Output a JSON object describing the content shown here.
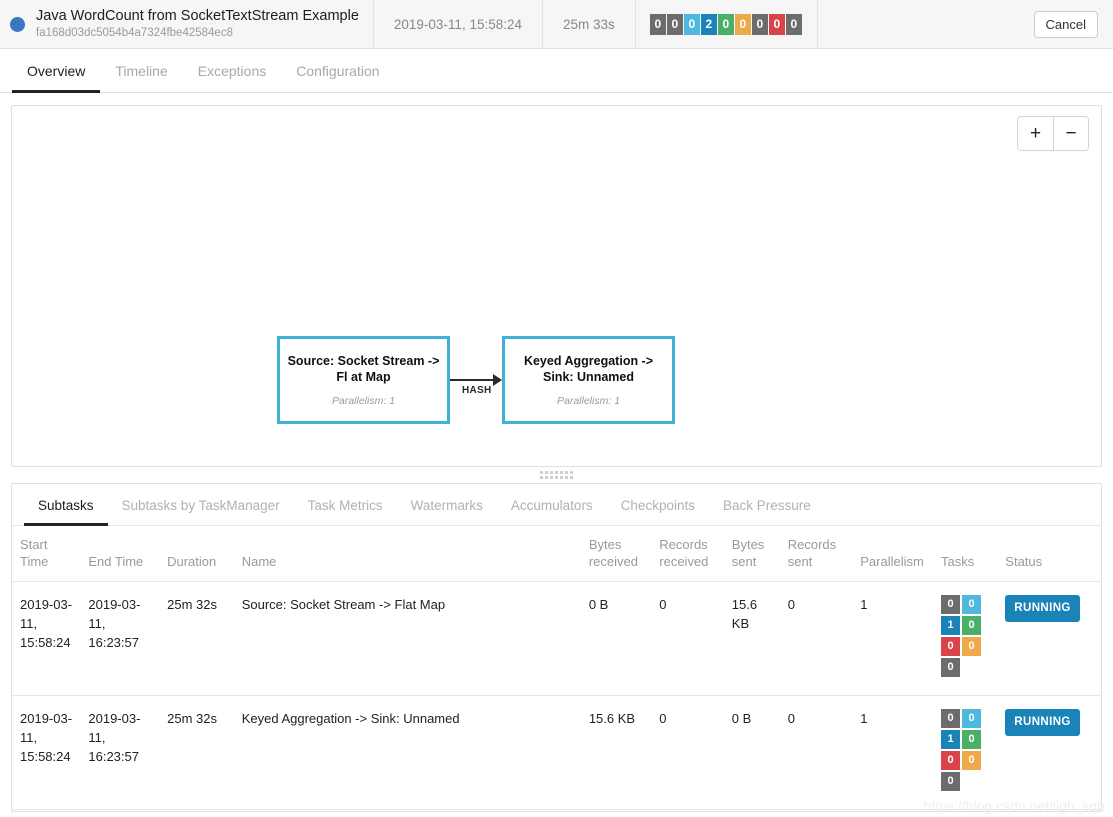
{
  "job_header": {
    "status_icon": "status-dot-running",
    "status_color": "#3b77c0",
    "job_name": "Java WordCount from SocketTextStream Example",
    "job_id": "fa168d03dc5054b4a7324fbe42584ec8",
    "start_time": "2019-03-11, 15:58:24",
    "duration": "25m 33s",
    "cancel_label": "Cancel",
    "status_badges": [
      {
        "value": "0",
        "color": "#6c6c6c",
        "state": "created"
      },
      {
        "value": "0",
        "color": "#6c6c6c",
        "state": "scheduled"
      },
      {
        "value": "0",
        "color": "#4fb8dd",
        "state": "deploying"
      },
      {
        "value": "2",
        "color": "#1a83b8",
        "state": "running"
      },
      {
        "value": "0",
        "color": "#4caf68",
        "state": "finished"
      },
      {
        "value": "0",
        "color": "#eda champion",
        "state": "canceling"
      },
      {
        "value": "0",
        "color": "#6c6c6c",
        "state": "canceled"
      },
      {
        "value": "0",
        "color": "#d9434a",
        "state": "failed"
      },
      {
        "value": "0",
        "color": "#6c6c6c",
        "state": "reconciling"
      }
    ]
  },
  "main_tabs": [
    {
      "label": "Overview",
      "active": true
    },
    {
      "label": "Timeline",
      "active": false
    },
    {
      "label": "Exceptions",
      "active": false
    },
    {
      "label": "Configuration",
      "active": false
    }
  ],
  "graph": {
    "zoom_in_label": "+",
    "zoom_out_label": "−",
    "edge_label": "HASH",
    "nodes": [
      {
        "title": "Source: Socket Stream -> Fl at Map",
        "subtitle": "Parallelism: 1",
        "border_color": "#3fb1d8"
      },
      {
        "title": "Keyed Aggregation -> Sink: Unnamed",
        "subtitle": "Parallelism: 1",
        "border_color": "#3fb1d8"
      }
    ]
  },
  "sub_tabs": [
    {
      "label": "Subtasks",
      "active": true
    },
    {
      "label": "Subtasks by TaskManager",
      "active": false
    },
    {
      "label": "Task Metrics",
      "active": false
    },
    {
      "label": "Watermarks",
      "active": false
    },
    {
      "label": "Accumulators",
      "active": false
    },
    {
      "label": "Checkpoints",
      "active": false
    },
    {
      "label": "Back Pressure",
      "active": false
    }
  ],
  "table": {
    "headers": [
      "Start Time",
      "End Time",
      "Duration",
      "Name",
      "Bytes received",
      "Records received",
      "Bytes sent",
      "Records sent",
      "Parallelism",
      "Tasks",
      "Status"
    ],
    "rows": [
      {
        "start_time": "2019-03-11, 15:58:24",
        "end_time": "2019-03-11, 16:23:57",
        "duration": "25m 32s",
        "name": "Source: Socket Stream -> Flat Map",
        "bytes_received": "0 B",
        "records_received": "0",
        "bytes_sent": "15.6 KB",
        "records_sent": "0",
        "parallelism": "1",
        "tasks": [
          {
            "value": "0",
            "color": "#6c6c6c"
          },
          {
            "value": "0",
            "color": "#4fb8dd"
          },
          {
            "value": "1",
            "color": "#1a83b8"
          },
          {
            "value": "0",
            "color": "#4caf68"
          },
          {
            "value": "0",
            "color": "#d9434a"
          },
          {
            "value": "0",
            "color": "#eda94a"
          },
          {
            "value": "0",
            "color": "#6c6c6c"
          }
        ],
        "status": "RUNNING",
        "status_color": "#1a83b8"
      },
      {
        "start_time": "2019-03-11, 15:58:24",
        "end_time": "2019-03-11, 16:23:57",
        "duration": "25m 32s",
        "name": "Keyed Aggregation -> Sink: Unnamed",
        "bytes_received": "15.6 KB",
        "records_received": "0",
        "bytes_sent": "0 B",
        "records_sent": "0",
        "parallelism": "1",
        "tasks": [
          {
            "value": "0",
            "color": "#6c6c6c"
          },
          {
            "value": "0",
            "color": "#4fb8dd"
          },
          {
            "value": "1",
            "color": "#1a83b8"
          },
          {
            "value": "0",
            "color": "#4caf68"
          },
          {
            "value": "0",
            "color": "#d9434a"
          },
          {
            "value": "0",
            "color": "#eda94a"
          },
          {
            "value": "0",
            "color": "#6c6c6c"
          }
        ],
        "status": "RUNNING",
        "status_color": "#1a83b8"
      }
    ]
  },
  "watermark": "https://blog.csdn.net/ligh_sqh"
}
